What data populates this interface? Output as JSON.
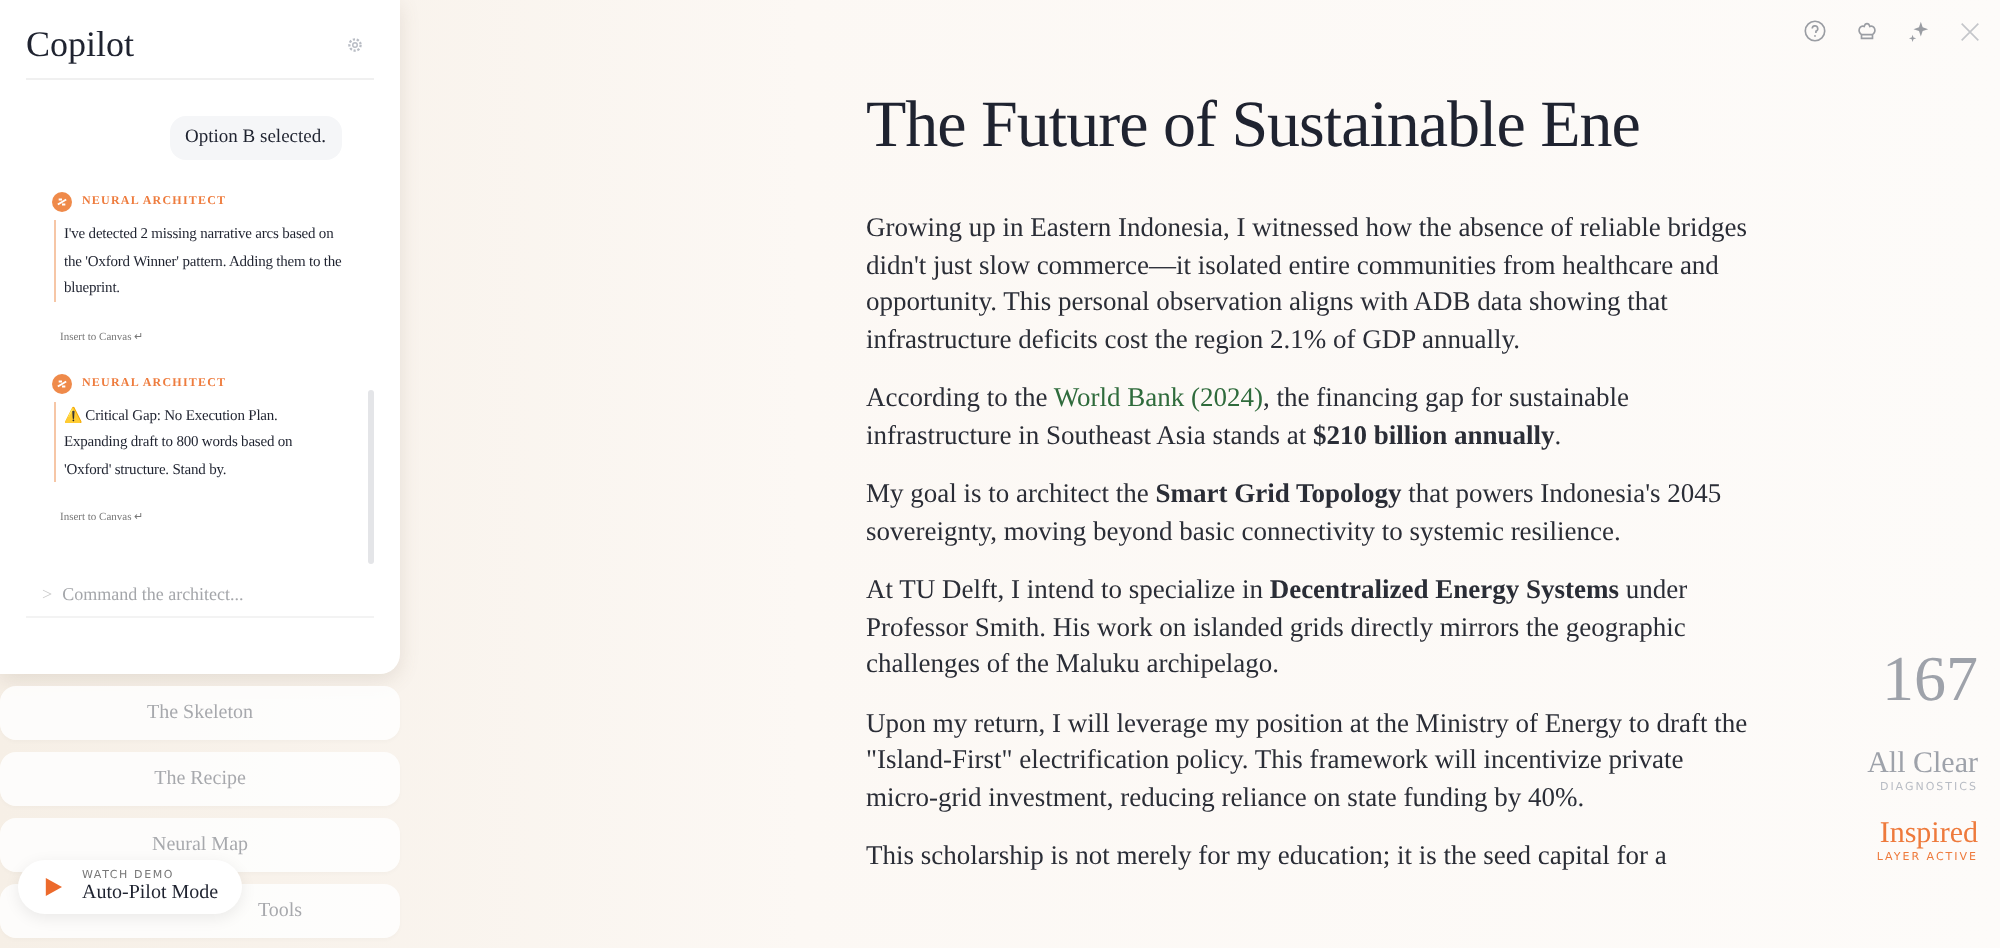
{
  "copilot": {
    "title": "Copilot",
    "messages": [
      {
        "kind": "user",
        "text": "Option B selected."
      },
      {
        "kind": "assistant",
        "author": "NEURAL ARCHITECT",
        "text": "I've detected 2 missing narrative arcs based on the 'Oxford Winner' pattern. Adding them to the blueprint.",
        "action": "Insert to Canvas ↵"
      },
      {
        "kind": "assistant",
        "author": "NEURAL ARCHITECT",
        "text": "⚠️ Critical Gap: No Execution Plan. Expanding draft to 800 words based on 'Oxford' structure. Stand by.",
        "action": "Insert to Canvas ↵"
      }
    ],
    "prompt": ">",
    "input_placeholder": "Command the architect..."
  },
  "nav": [
    "The Skeleton",
    "The Recipe",
    "Neural Map",
    "Tools"
  ],
  "demo": {
    "caption": "WATCH DEMO",
    "label": "Auto-Pilot Mode"
  },
  "article": {
    "title": "The Future of Sustainable Ene",
    "paragraphs": [
      [
        {
          "kind": "text",
          "text": "Growing up in Eastern Indonesia, I witnessed how the absence of reliable bridges didn't just slow commerce—it isolated entire communities from healthcare and opportunity. This personal observation aligns with ADB data showing that infrastructure deficits cost the region 2.1% of GDP annually."
        }
      ],
      [
        {
          "kind": "text",
          "text": "According to the "
        },
        {
          "kind": "link",
          "text": "World Bank (2024)"
        },
        {
          "kind": "text",
          "text": ", the financing gap for sustainable infrastructure in Southeast Asia stands at **$210 billion annually**."
        }
      ],
      [
        {
          "kind": "text",
          "text": "My goal is to architect the **Smart Grid Topology** that powers Indonesia's 2045 sovereignty, moving beyond basic connectivity to systemic resilience."
        }
      ],
      [
        {
          "kind": "text",
          "text": "At TU Delft, I intend to specialize in **Decentralized Energy Systems** under Professor Smith. His work on islanded grids directly mirrors the geographic challenges of the Maluku archipelago."
        }
      ],
      [
        {
          "kind": "text",
          "text": "Upon my return, I will leverage my position at the Ministry of Energy to draft the \"Island-First\" electrification policy. This framework will incentivize private micro-grid investment, reducing reliance on state funding by 40%."
        }
      ],
      [
        {
          "kind": "text",
          "text": "This scholarship is not merely for my education; it is the seed capital for a"
        }
      ]
    ]
  },
  "stats": [
    {
      "value": "167"
    },
    {
      "value": "All Clear",
      "caption": "DIAGNOSTICS",
      "active": false
    },
    {
      "value": "Inspired",
      "caption": "LAYER ACTIVE",
      "active": true
    }
  ]
}
